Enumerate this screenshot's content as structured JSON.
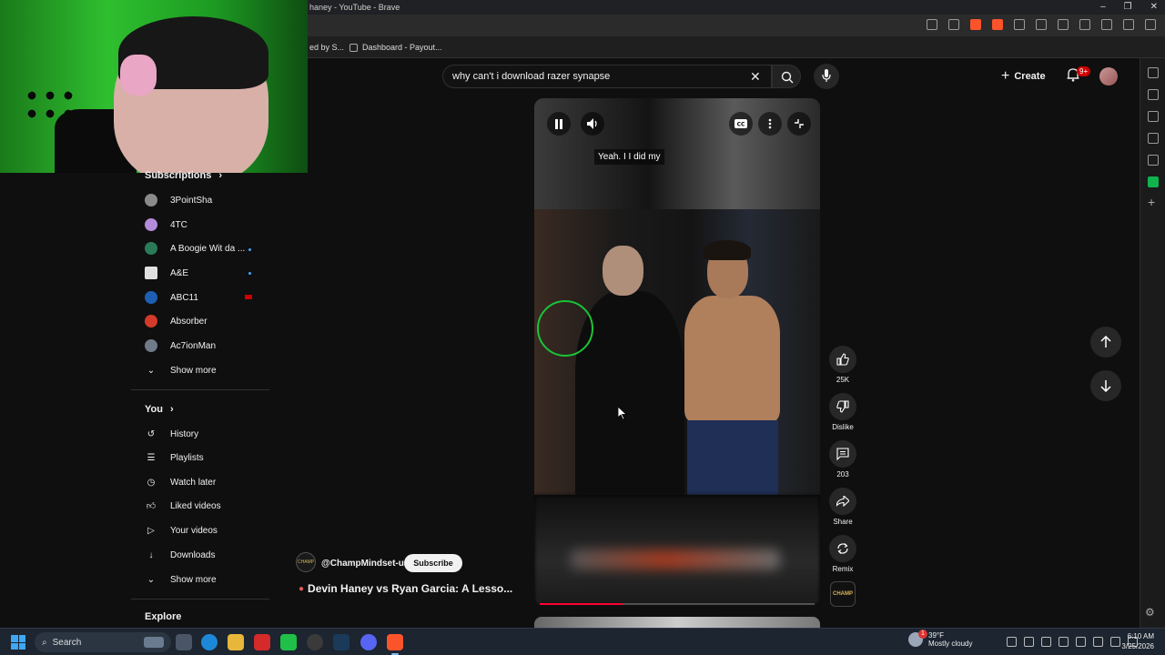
{
  "browser": {
    "window_title": "haney - YouTube - Brave",
    "bookmarks": [
      {
        "label": "ed by S..."
      },
      {
        "label": "Dashboard - Payout..."
      }
    ]
  },
  "youtube": {
    "search": {
      "value": "why can't i download razer synapse",
      "placeholder": "Search"
    },
    "header": {
      "create_label": "Create",
      "notif_count": "9+"
    }
  },
  "guide": {
    "subscriptions_title": "Subscriptions",
    "subscriptions": [
      {
        "name": "3PointSha",
        "color": "#8a8a8a"
      },
      {
        "name": "4TC",
        "color": "#b48bd8"
      },
      {
        "name": "A Boogie Wit da ...",
        "color": "#2a7a5a"
      },
      {
        "name": "A&E",
        "color": "#e0e0e0"
      },
      {
        "name": "ABC11",
        "color": "#1e5fb3"
      },
      {
        "name": "Absorber",
        "color": "#d43a2a"
      },
      {
        "name": "Ac7ionMan",
        "color": "#707a88"
      }
    ],
    "show_more_1": "Show more",
    "you_title": "You",
    "you_items": [
      {
        "label": "History",
        "icon": "history-icon"
      },
      {
        "label": "Playlists",
        "icon": "playlists-icon"
      },
      {
        "label": "Watch later",
        "icon": "watch-later-icon"
      },
      {
        "label": "Liked videos",
        "icon": "like-icon"
      },
      {
        "label": "Your videos",
        "icon": "your-videos-icon"
      },
      {
        "label": "Downloads",
        "icon": "download-icon"
      }
    ],
    "show_more_2": "Show more",
    "explore_title": "Explore"
  },
  "short": {
    "caption": "Yeah. I I did my",
    "channel": "@ChampMindset-us",
    "subscribe_label": "Subscribe",
    "title": "Devin Haney vs Ryan Garcia: A Lesso...",
    "progress": 0.3,
    "actions": {
      "likes": "25K",
      "dislike_label": "Dislike",
      "comments": "203",
      "share_label": "Share",
      "remix_label": "Remix"
    }
  },
  "taskbar": {
    "search_label": "Search",
    "weather_temp": "39°F",
    "weather_desc": "Mostly cloudy",
    "weather_badge": "1",
    "time": "6:10 AM",
    "date": "3/25/2026"
  },
  "colors": {
    "accent_red": "#ff0033",
    "brave_orange": "#fb542b",
    "link_blue": "#3ea6ff"
  }
}
